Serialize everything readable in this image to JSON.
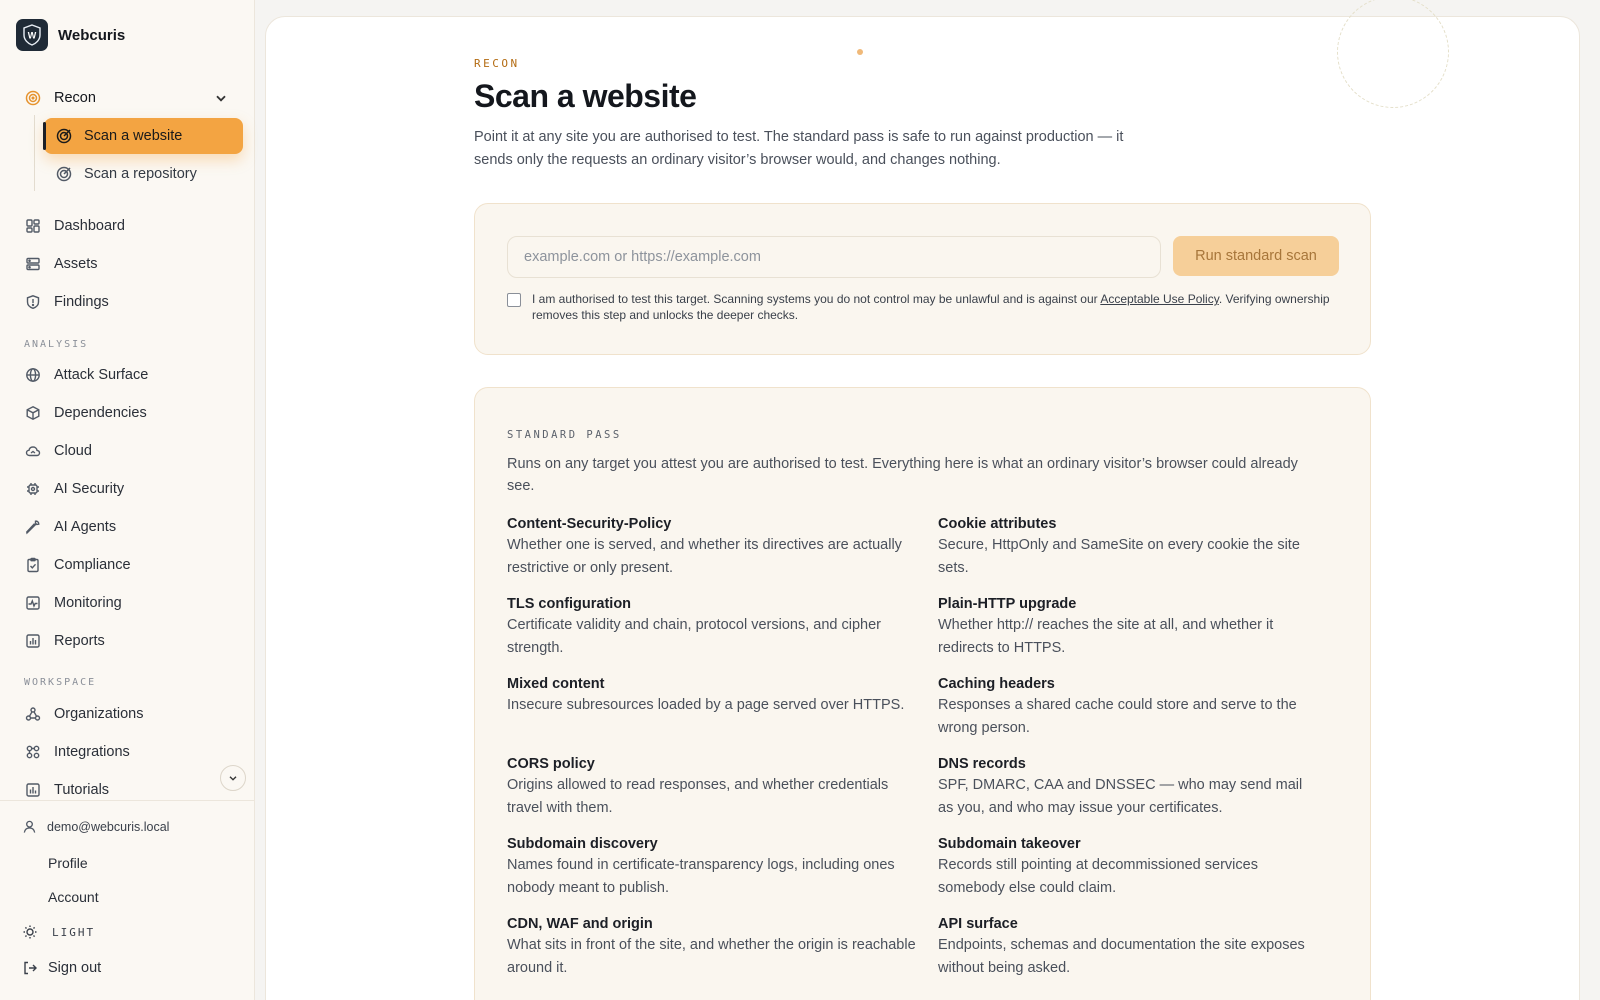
{
  "brand": {
    "name": "Webcuris",
    "logo_letter": "W"
  },
  "nav": {
    "recon": {
      "label": "Recon",
      "children": [
        {
          "label": "Scan a website",
          "active": true
        },
        {
          "label": "Scan a repository",
          "active": false
        }
      ]
    },
    "main_items": [
      {
        "label": "Dashboard",
        "icon": "dashboard-icon"
      },
      {
        "label": "Assets",
        "icon": "server-icon"
      },
      {
        "label": "Findings",
        "icon": "shield-icon"
      }
    ],
    "analysis_label": "ANALYSIS",
    "analysis_items": [
      {
        "label": "Attack Surface",
        "icon": "globe-icon"
      },
      {
        "label": "Dependencies",
        "icon": "package-icon"
      },
      {
        "label": "Cloud",
        "icon": "cloud-icon"
      },
      {
        "label": "AI Security",
        "icon": "chip-icon"
      },
      {
        "label": "AI Agents",
        "icon": "wrench-icon"
      },
      {
        "label": "Compliance",
        "icon": "clipboard-icon"
      },
      {
        "label": "Monitoring",
        "icon": "activity-icon"
      },
      {
        "label": "Reports",
        "icon": "bar-chart-icon"
      }
    ],
    "workspace_label": "WORKSPACE",
    "workspace_items": [
      {
        "label": "Organizations",
        "icon": "org-icon"
      },
      {
        "label": "Integrations",
        "icon": "integrations-icon"
      },
      {
        "label": "Tutorials",
        "icon": "tutorials-icon"
      }
    ]
  },
  "footer": {
    "email": "demo@webcuris.local",
    "profile": "Profile",
    "account": "Account",
    "theme": "LIGHT",
    "sign_out": "Sign out"
  },
  "page": {
    "eyebrow": "RECON",
    "title": "Scan a website",
    "description": "Point it at any site you are authorised to test. The standard pass is safe to run against production — it sends only the requests an ordinary visitor’s browser would, and changes nothing."
  },
  "scan_form": {
    "placeholder": "example.com or https://example.com",
    "value": "",
    "run_label": "Run standard scan",
    "auth_text_before": "I am authorised to test this target. Scanning systems you do not control may be unlawful and is against our ",
    "auth_link": "Acceptable Use Policy",
    "auth_text_after": ". Verifying ownership removes this step and unlocks the deeper checks.",
    "checked": false
  },
  "standard_pass": {
    "label": "STANDARD PASS",
    "description": "Runs on any target you attest you are authorised to test. Everything here is what an ordinary visitor’s browser could already see.",
    "checks": [
      {
        "name": "Content-Security-Policy",
        "desc": "Whether one is served, and whether its directives are actually restrictive or only present."
      },
      {
        "name": "Cookie attributes",
        "desc": "Secure, HttpOnly and SameSite on every cookie the site sets."
      },
      {
        "name": "TLS configuration",
        "desc": "Certificate validity and chain, protocol versions, and cipher strength."
      },
      {
        "name": "Plain-HTTP upgrade",
        "desc": "Whether http:// reaches the site at all, and whether it redirects to HTTPS."
      },
      {
        "name": "Mixed content",
        "desc": "Insecure subresources loaded by a page served over HTTPS."
      },
      {
        "name": "Caching headers",
        "desc": "Responses a shared cache could store and serve to the wrong person."
      },
      {
        "name": "CORS policy",
        "desc": "Origins allowed to read responses, and whether credentials travel with them."
      },
      {
        "name": "DNS records",
        "desc": "SPF, DMARC, CAA and DNSSEC — who may send mail as you, and who may issue your certificates."
      },
      {
        "name": "Subdomain discovery",
        "desc": "Names found in certificate-transparency logs, including ones nobody meant to publish."
      },
      {
        "name": "Subdomain takeover",
        "desc": "Records still pointing at decommissioned services somebody else could claim."
      },
      {
        "name": "CDN, WAF and origin",
        "desc": "What sits in front of the site, and whether the origin is reachable around it."
      },
      {
        "name": "API surface",
        "desc": "Endpoints, schemas and documentation the site exposes without being asked."
      }
    ]
  },
  "colors": {
    "accent": "#f3a442",
    "accent_soft": "#f6cf99",
    "eyebrow": "#b36b12",
    "sidebar_bg": "#fbf8f3",
    "card_bg": "#faf6ef"
  }
}
